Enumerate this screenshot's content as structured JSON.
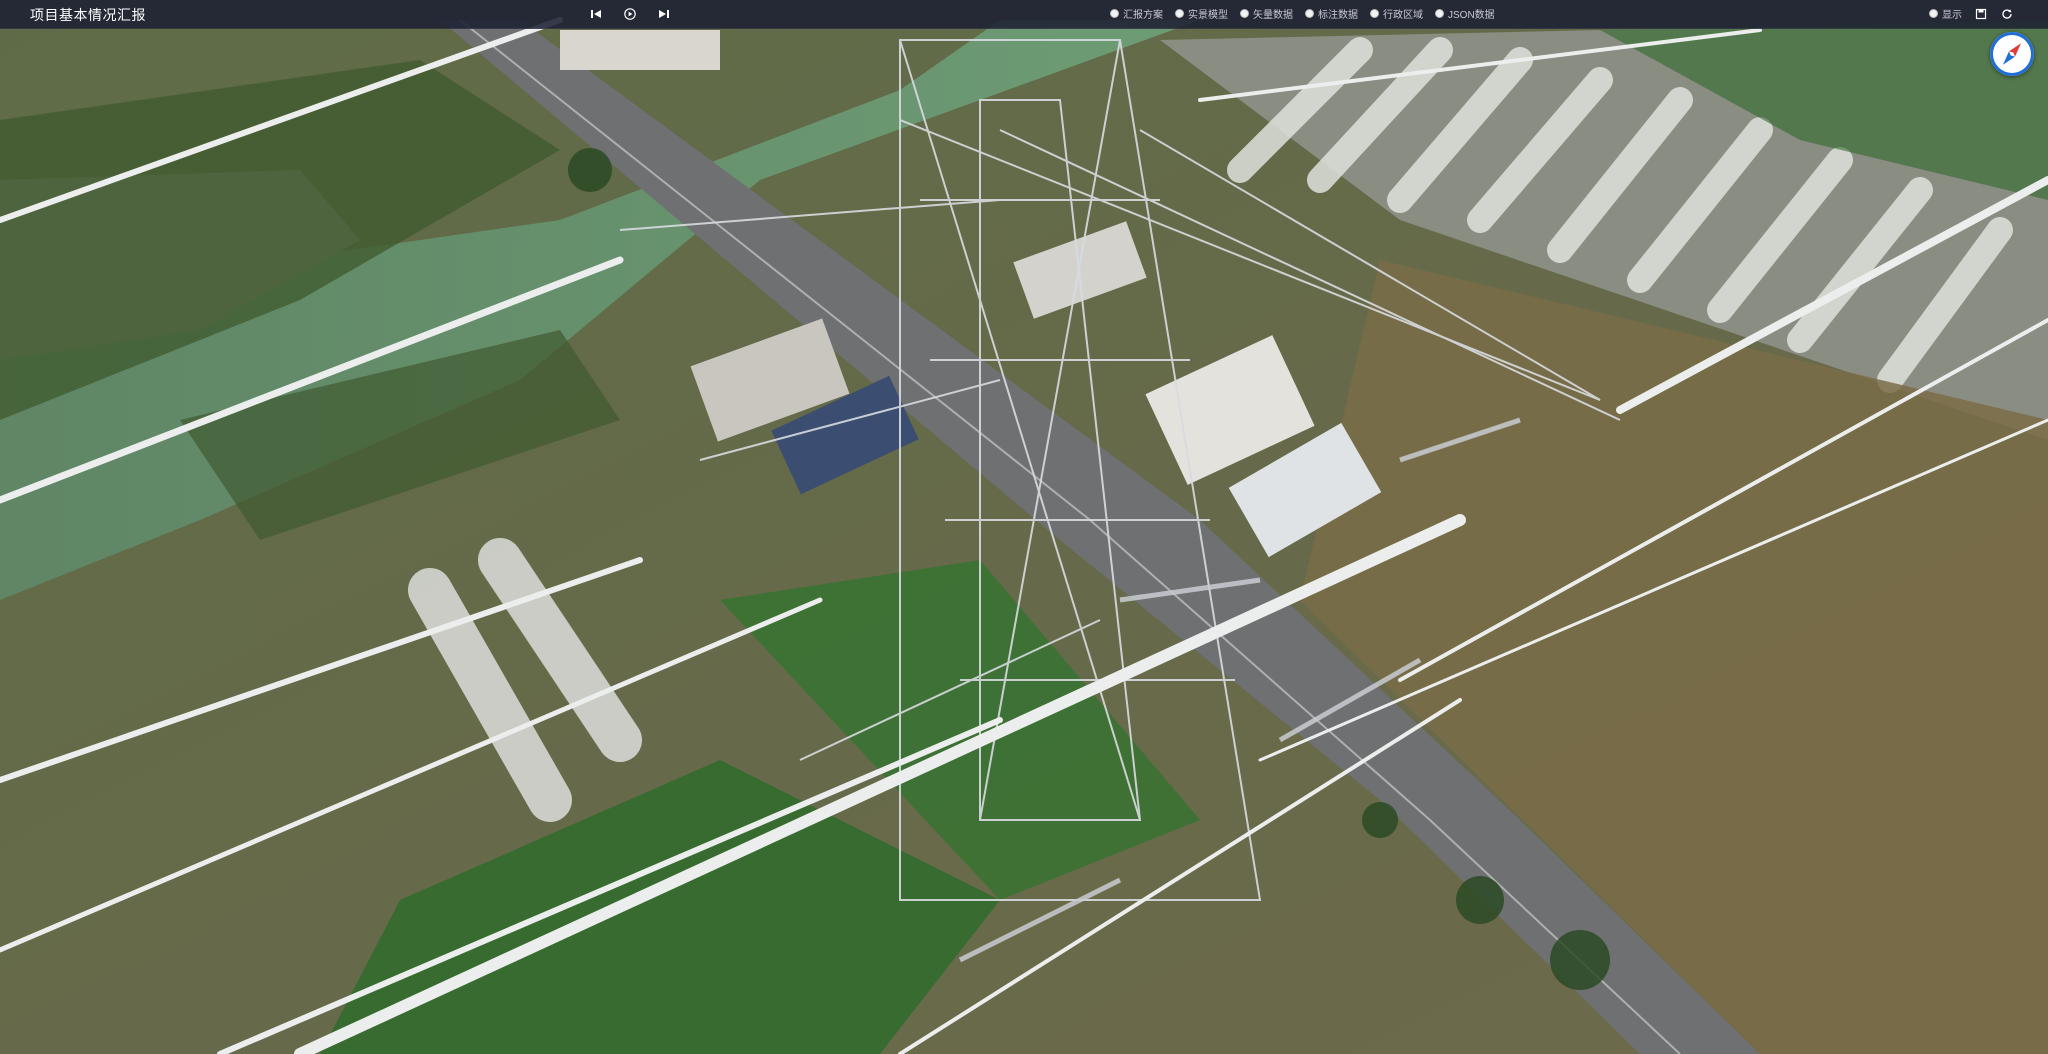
{
  "header": {
    "title": "项目基本情况汇报"
  },
  "player": {
    "prev_icon": "skip-back-icon",
    "play_icon": "play-icon",
    "next_icon": "skip-forward-icon"
  },
  "layers": [
    {
      "label": "汇报方案"
    },
    {
      "label": "实景模型"
    },
    {
      "label": "矢量数据"
    },
    {
      "label": "标注数据"
    },
    {
      "label": "行政区域"
    },
    {
      "label": "JSON数据"
    }
  ],
  "tools": {
    "display_label": "显示",
    "save_icon": "save-icon",
    "refresh_icon": "refresh-icon"
  },
  "compass": {
    "icon": "compass-icon"
  },
  "colors": {
    "topbar": "#1c2032",
    "accent": "#1f6fd6",
    "compass_needle": "#e23b3b"
  }
}
